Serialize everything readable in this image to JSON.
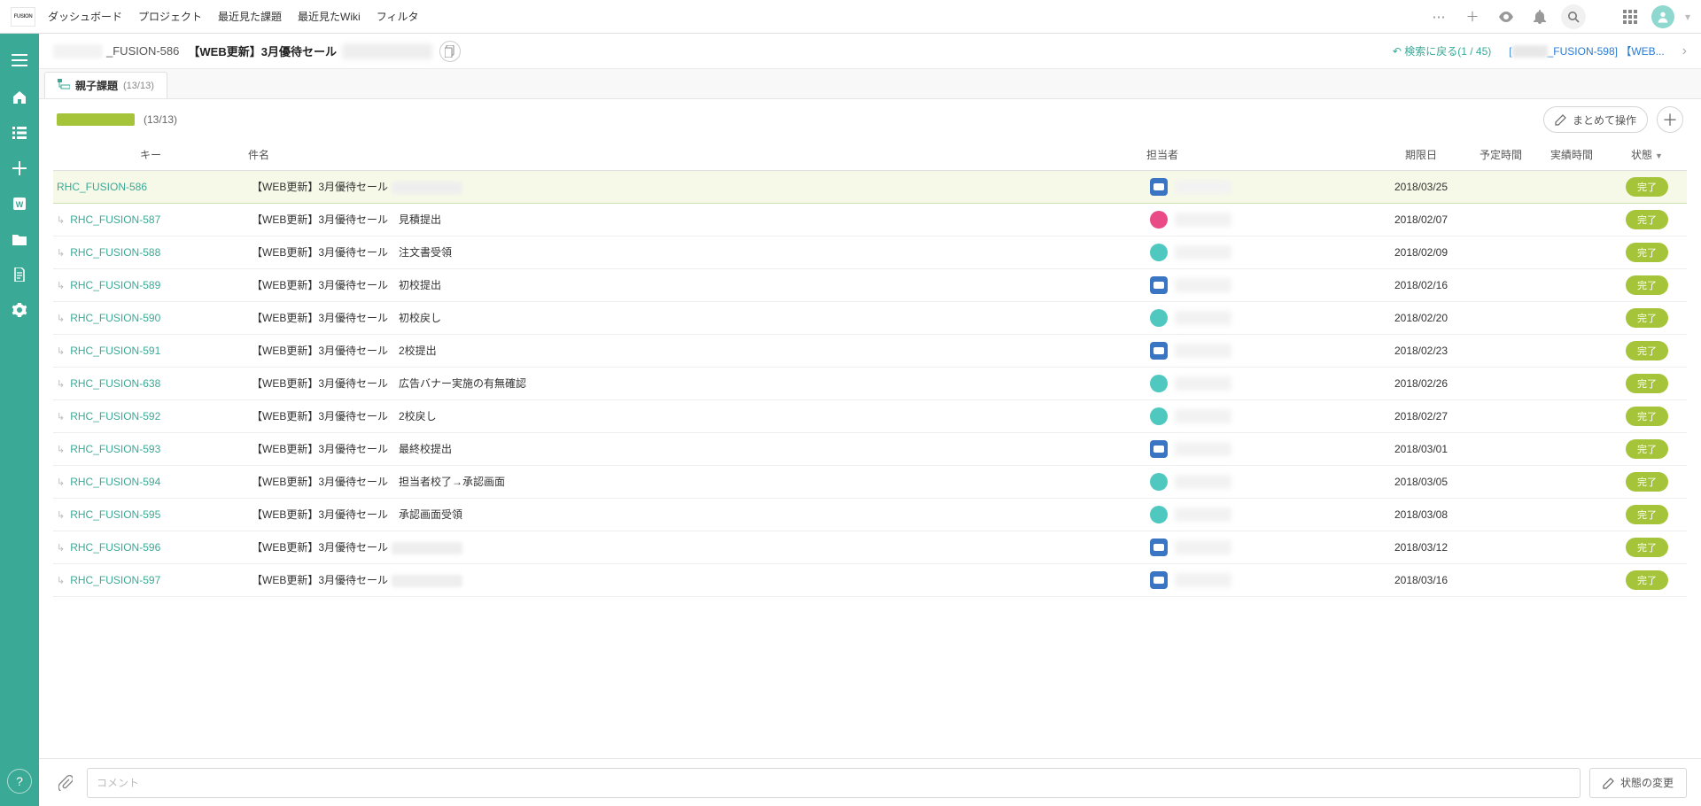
{
  "topnav": {
    "logo": "FUSION",
    "items": [
      "ダッシュボード",
      "プロジェクト",
      "最近見た課題",
      "最近見たWiki",
      "フィルタ"
    ]
  },
  "issueHeader": {
    "keySuffix": "_FUSION-586",
    "title": "【WEB更新】3月優待セール",
    "backToSearch": "検索に戻る(1 / 45)",
    "nextIssueKey": "_FUSION-598]",
    "nextIssueTitle": "【WEB..."
  },
  "tab": {
    "label": "親子課題",
    "count": "(13/13)"
  },
  "progress": {
    "count": "(13/13)",
    "bulkLabel": "まとめて操作"
  },
  "columns": {
    "key": "キー",
    "subject": "件名",
    "assignee": "担当者",
    "due": "期限日",
    "estimated": "予定時間",
    "actual": "実績時間",
    "status": "状態"
  },
  "statusLabel": "完了",
  "rows": [
    {
      "key": "RHC_FUSION-586",
      "child": false,
      "highlight": true,
      "subject": "【WEB更新】3月優待セール",
      "subjectBlur": true,
      "avatar": "robot",
      "due": "2018/03/25"
    },
    {
      "key": "RHC_FUSION-587",
      "child": true,
      "highlight": false,
      "subject": "【WEB更新】3月優待セール　見積提出",
      "subjectBlur": false,
      "avatar": "pink",
      "due": "2018/02/07"
    },
    {
      "key": "RHC_FUSION-588",
      "child": true,
      "highlight": false,
      "subject": "【WEB更新】3月優待セール　注文書受領",
      "subjectBlur": false,
      "avatar": "teal",
      "due": "2018/02/09"
    },
    {
      "key": "RHC_FUSION-589",
      "child": true,
      "highlight": false,
      "subject": "【WEB更新】3月優待セール　初校提出",
      "subjectBlur": false,
      "avatar": "robot",
      "due": "2018/02/16"
    },
    {
      "key": "RHC_FUSION-590",
      "child": true,
      "highlight": false,
      "subject": "【WEB更新】3月優待セール　初校戻し",
      "subjectBlur": false,
      "avatar": "teal",
      "due": "2018/02/20"
    },
    {
      "key": "RHC_FUSION-591",
      "child": true,
      "highlight": false,
      "subject": "【WEB更新】3月優待セール　2校提出",
      "subjectBlur": false,
      "avatar": "robot",
      "due": "2018/02/23"
    },
    {
      "key": "RHC_FUSION-638",
      "child": true,
      "highlight": false,
      "subject": "【WEB更新】3月優待セール　広告バナー実施の有無確認",
      "subjectBlur": false,
      "avatar": "teal",
      "due": "2018/02/26"
    },
    {
      "key": "RHC_FUSION-592",
      "child": true,
      "highlight": false,
      "subject": "【WEB更新】3月優待セール　2校戻し",
      "subjectBlur": false,
      "avatar": "teal",
      "due": "2018/02/27"
    },
    {
      "key": "RHC_FUSION-593",
      "child": true,
      "highlight": false,
      "subject": "【WEB更新】3月優待セール　最終校提出",
      "subjectBlur": false,
      "avatar": "robot",
      "due": "2018/03/01"
    },
    {
      "key": "RHC_FUSION-594",
      "child": true,
      "highlight": false,
      "subject": "【WEB更新】3月優待セール　担当者校了→承認画面",
      "subjectBlur": false,
      "avatar": "teal",
      "due": "2018/03/05"
    },
    {
      "key": "RHC_FUSION-595",
      "child": true,
      "highlight": false,
      "subject": "【WEB更新】3月優待セール　承認画面受領",
      "subjectBlur": false,
      "avatar": "teal",
      "due": "2018/03/08"
    },
    {
      "key": "RHC_FUSION-596",
      "child": true,
      "highlight": false,
      "subject": "【WEB更新】3月優待セール",
      "subjectBlur": true,
      "avatar": "robot",
      "due": "2018/03/12"
    },
    {
      "key": "RHC_FUSION-597",
      "child": true,
      "highlight": false,
      "subject": "【WEB更新】3月優待セール",
      "subjectBlur": true,
      "avatar": "robot",
      "due": "2018/03/16"
    }
  ],
  "footer": {
    "commentPlaceholder": "コメント",
    "statusChange": "状態の変更"
  }
}
